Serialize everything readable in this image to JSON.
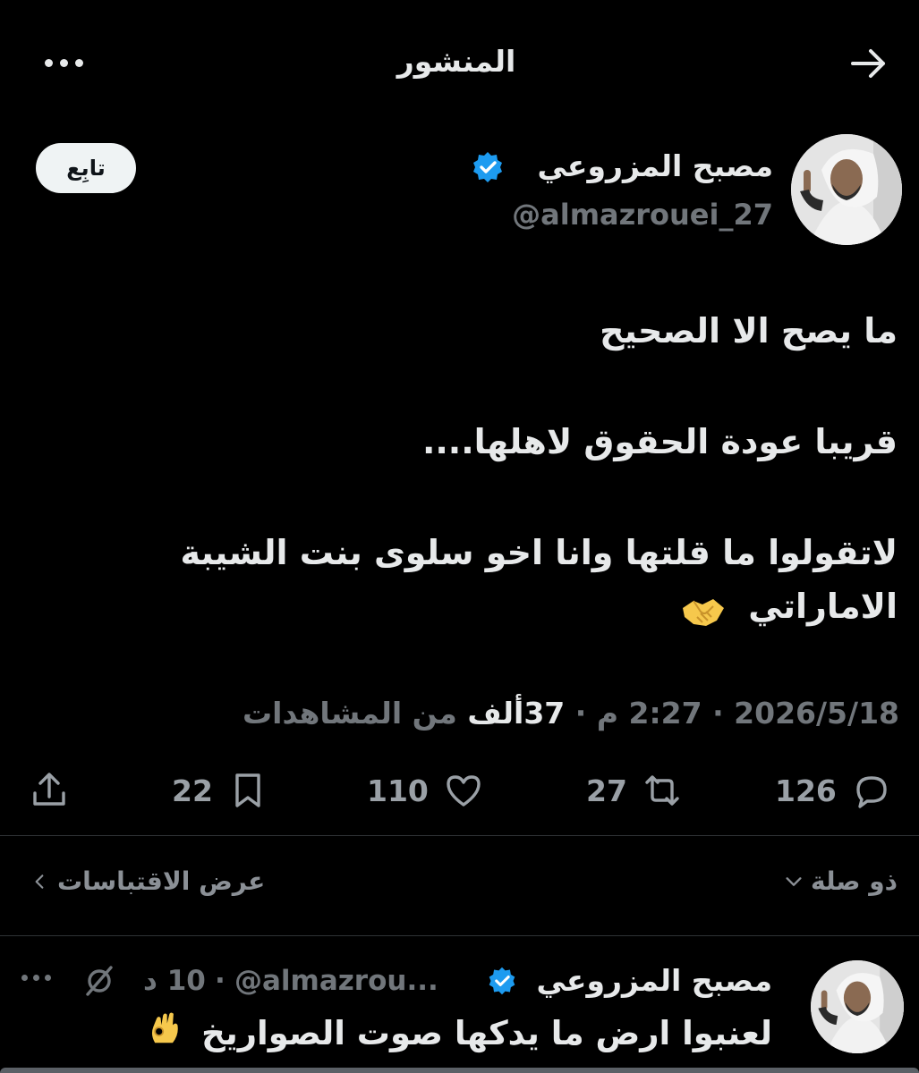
{
  "header": {
    "title": "المنشور",
    "back_icon": "arrow-right-icon",
    "more_icon": "more-horizontal-icon"
  },
  "author": {
    "name": "مصبح المزروعي",
    "handle": "@almazrouei_27",
    "verified": true,
    "follow_label": "تابِع"
  },
  "post": {
    "lines": [
      "ما يصح الا الصحيح",
      "قريبا عودة الحقوق لاهلها....",
      "لاتقولوا ما قلتها وانا اخو سلوى بنت الشيبة",
      "الاماراتي"
    ],
    "emoji": "handshake-emoji"
  },
  "meta": {
    "date": "2026/5/18",
    "time": "2:27 م",
    "separator": "·",
    "views_count": "37ألف",
    "views_label": "من المشاهدات"
  },
  "actions": {
    "replies": "126",
    "reposts": "27",
    "likes": "110",
    "bookmarks": "22"
  },
  "footer": {
    "relevance_label": "ذو صلة",
    "quotes_label": "عرض الاقتباسات"
  },
  "reply": {
    "name": "مصبح المزروعي",
    "handle": "@almazrou...",
    "separator": "·",
    "time": "10 د",
    "text": "لعنبوا ارض ما يدكها صوت الصواريخ",
    "emoji": "ok-hand-emoji"
  },
  "colors": {
    "background": "#000000",
    "text_primary": "#e7e9ea",
    "text_secondary": "#71767b",
    "verified_blue": "#1d9bf0",
    "follow_bg": "#eff3f4"
  }
}
